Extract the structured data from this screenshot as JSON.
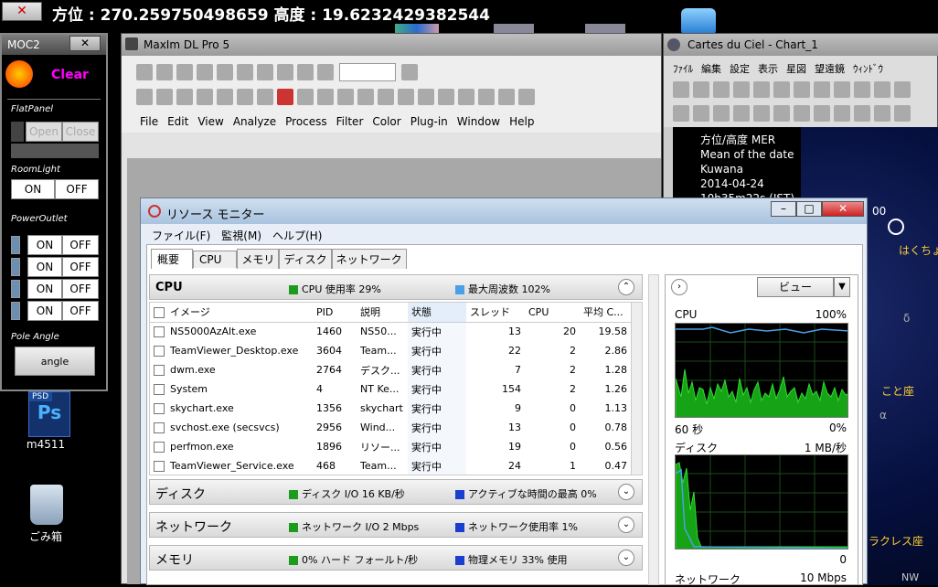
{
  "topbar": {
    "close_label": "✕",
    "status": "方位 : 270.259750498659    高度 : 19.6232429382544"
  },
  "desktop": {
    "psd_label": "m4511",
    "psd_badge": "PSD",
    "psd_glyph": "Ps",
    "recycle_label": "ごみ箱"
  },
  "moc2": {
    "title": "MOC2",
    "close": "✕",
    "status": "Clear",
    "flat_label": "FlatPanel",
    "flat_open": "Open",
    "flat_close": "Close",
    "roomlight_label": "RoomLight",
    "on": "ON",
    "off": "OFF",
    "power_label": "PowerOutlet",
    "pole_label": "Pole Angle",
    "angle_btn": "angle"
  },
  "maxim": {
    "title": "MaxIm DL Pro 5",
    "menu": [
      "File",
      "Edit",
      "View",
      "Analyze",
      "Process",
      "Filter",
      "Color",
      "Plug-in",
      "Window",
      "Help"
    ]
  },
  "carte": {
    "title": "Cartes du Ciel - Chart_1",
    "menu": [
      "ﾌｧｲﾙ",
      "編集",
      "設定",
      "表示",
      "星図",
      "望遠鏡",
      "ｳｨﾝﾄﾞｳ"
    ],
    "info": [
      "方位/高度 MER",
      "Mean of the date",
      "Kuwana",
      "2014-04-24",
      "10h35m22s (JST)"
    ],
    "labels": {
      "hakucho": "はくちょう",
      "koto": "こと座",
      "herc": "ラクレス座",
      "nw": "NW",
      "num": "00",
      "delta": "δ",
      "alpha": "α"
    }
  },
  "rm": {
    "title": "リソース モニター",
    "menu": [
      "ファイル(F)",
      "監視(M)",
      "ヘルプ(H)"
    ],
    "tabs": [
      "概要",
      "CPU",
      "メモリ",
      "ディスク",
      "ネットワーク"
    ],
    "cpu": {
      "title": "CPU",
      "usage": "CPU 使用率 29%",
      "freq": "最大周波数 102%",
      "columns": [
        "イメージ",
        "PID",
        "説明",
        "状態",
        "スレッド",
        "CPU",
        "平均 C..."
      ],
      "rows": [
        {
          "name": "NS5000AzAlt.exe",
          "pid": "1460",
          "desc": "NS50...",
          "state": "実行中",
          "threads": "13",
          "cpu": "20",
          "avg": "19.58"
        },
        {
          "name": "TeamViewer_Desktop.exe",
          "pid": "3604",
          "desc": "Team...",
          "state": "実行中",
          "threads": "22",
          "cpu": "2",
          "avg": "2.86"
        },
        {
          "name": "dwm.exe",
          "pid": "2764",
          "desc": "デスク...",
          "state": "実行中",
          "threads": "7",
          "cpu": "2",
          "avg": "1.28"
        },
        {
          "name": "System",
          "pid": "4",
          "desc": "NT Ke...",
          "state": "実行中",
          "threads": "154",
          "cpu": "2",
          "avg": "1.26"
        },
        {
          "name": "skychart.exe",
          "pid": "1356",
          "desc": "skychart",
          "state": "実行中",
          "threads": "9",
          "cpu": "0",
          "avg": "1.13"
        },
        {
          "name": "svchost.exe (secsvcs)",
          "pid": "2956",
          "desc": "Wind...",
          "state": "実行中",
          "threads": "13",
          "cpu": "0",
          "avg": "0.78"
        },
        {
          "name": "perfmon.exe",
          "pid": "1896",
          "desc": "リソー...",
          "state": "実行中",
          "threads": "19",
          "cpu": "0",
          "avg": "0.56"
        },
        {
          "name": "TeamViewer_Service.exe",
          "pid": "468",
          "desc": "Team...",
          "state": "実行中",
          "threads": "24",
          "cpu": "1",
          "avg": "0.47"
        }
      ]
    },
    "disk": {
      "title": "ディスク",
      "io": "ディスク I/O 16 KB/秒",
      "active": "アクティブな時間の最高 0%"
    },
    "net": {
      "title": "ネットワーク",
      "io": "ネットワーク I/O 2 Mbps",
      "usage": "ネットワーク使用率 1%"
    },
    "mem": {
      "title": "メモリ",
      "faults": "0% ハード フォールト/秒",
      "phys": "物理メモリ 33% 使用"
    },
    "right": {
      "view_btn": "ビュー",
      "cpu_label": "CPU",
      "cpu_max": "100%",
      "cpu_time": "60 秒",
      "cpu_min": "0%",
      "disk_label": "ディスク",
      "disk_max": "1 MB/秒",
      "disk_min": "0",
      "net_label": "ネットワーク",
      "net_max": "10 Mbps"
    },
    "colors": {
      "green": "#1e9a1e",
      "blue": "#1a3fd0",
      "lightblue": "#4aa0e8"
    }
  }
}
